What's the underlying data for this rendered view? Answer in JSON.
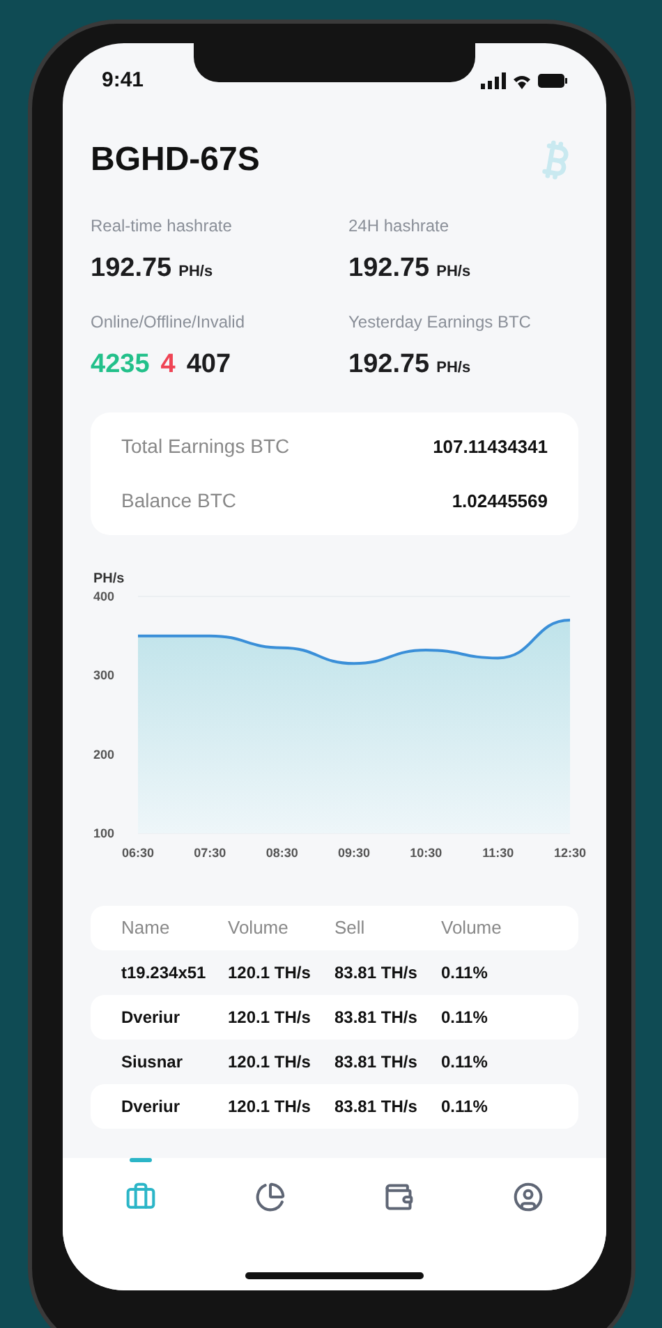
{
  "status_bar": {
    "time": "9:41"
  },
  "title": "BGHD-67S",
  "stats": [
    {
      "label": "Real-time hashrate",
      "value": "192.75",
      "unit": "PH/s"
    },
    {
      "label": "24H hashrate",
      "value": "192.75",
      "unit": "PH/s"
    },
    {
      "label": "Online/Offline/Invalid",
      "counts": [
        {
          "value": "4235",
          "color": "#22c08a"
        },
        {
          "value": "4",
          "color": "#ef4455"
        },
        {
          "value": "407",
          "color": "#1c1c1e"
        }
      ]
    },
    {
      "label": "Yesterday Earnings BTC",
      "value": "192.75",
      "unit": "PH/s"
    }
  ],
  "earnings": [
    {
      "label": "Total Earnings BTC",
      "value": "107.11434341"
    },
    {
      "label": "Balance BTC",
      "value": "1.02445569"
    }
  ],
  "chart": {
    "chart_data": {
      "type": "area",
      "ylabel": "PH/s",
      "categories": [
        "06:30",
        "07:30",
        "08:30",
        "09:30",
        "10:30",
        "11:30",
        "12:30"
      ],
      "series": [
        {
          "color": "#3a8fd8",
          "values": [
            350,
            350,
            335,
            315,
            332,
            322,
            370
          ]
        }
      ],
      "ylim": [
        100,
        400
      ],
      "yticks": [
        100,
        200,
        300,
        400
      ]
    }
  },
  "table": {
    "columns": [
      "Name",
      "Volume",
      "Sell",
      "Volume"
    ],
    "rows": [
      [
        "t19.234x51",
        "120.1 TH/s",
        "83.81 TH/s",
        "0.11%"
      ],
      [
        "Dveriur",
        "120.1 TH/s",
        "83.81 TH/s",
        "0.11%"
      ],
      [
        "Siusnar",
        "120.1 TH/s",
        "83.81 TH/s",
        "0.11%"
      ],
      [
        "Dveriur",
        "120.1 TH/s",
        "83.81 TH/s",
        "0.11%"
      ]
    ]
  },
  "tab_bar": [
    {
      "selected": true
    },
    {
      "selected": false
    },
    {
      "selected": false
    },
    {
      "selected": false
    }
  ]
}
